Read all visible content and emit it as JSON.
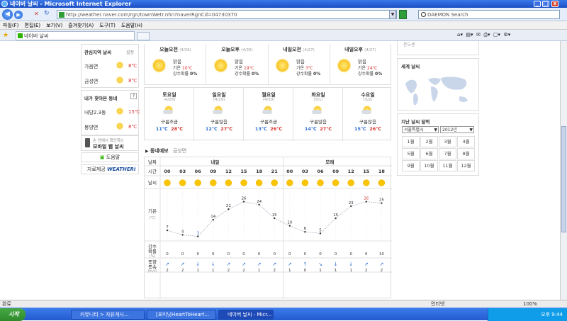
{
  "window": {
    "title": "네이버 날씨 - Microsoft Internet Explorer"
  },
  "address": {
    "url": "http://weather.naver.com/rgn/townWetr.nhn?naverRgnCd=04730370",
    "search_placeholder": "DAEMON Search"
  },
  "menu": [
    "파일(F)",
    "편집(E)",
    "보기(V)",
    "즐겨찾기(A)",
    "도구(T)",
    "도움말(H)"
  ],
  "tab": {
    "label": "네이버 날씨"
  },
  "sidebar": {
    "fav_title": "관심지역 날씨",
    "fav_setting": "설정",
    "fav_items": [
      {
        "name": "가음면",
        "temp": "8℃"
      },
      {
        "name": "금성면",
        "temp": "8℃"
      }
    ],
    "nearby_title": "내가 찾아본 동네",
    "nearby_help": "?",
    "nearby_items": [
      {
        "name": "내당2.3동",
        "temp": "15℃"
      },
      {
        "name": "봉양면",
        "temp": "8℃"
      }
    ],
    "mobile_small": "손 안에서 확인하는",
    "mobile_big": "모바일 웹 날씨",
    "help": "도움말",
    "source_label": "자료제공",
    "source_brand": "WEATHERi"
  },
  "forecast2day": [
    {
      "label": "오늘오전",
      "date": "(4/26)",
      "desc": "맑음",
      "temp_label": "기온",
      "temp": "10℃",
      "rain_label": "강수확률",
      "rain": "0%"
    },
    {
      "label": "오늘오후",
      "date": "(4/26)",
      "desc": "맑음",
      "temp_label": "기온",
      "temp": "19℃",
      "rain_label": "강수확률",
      "rain": "0%"
    },
    {
      "label": "내일오전",
      "date": "(4/27)",
      "desc": "맑음",
      "temp_label": "기온",
      "temp": "3℃",
      "rain_label": "강수확률",
      "rain": "0%"
    },
    {
      "label": "내일오후",
      "date": "(4/27)",
      "desc": "맑음",
      "temp_label": "기온",
      "temp": "24℃",
      "rain_label": "강수확률",
      "rain": "0%"
    }
  ],
  "weekly": [
    {
      "day": "토요일",
      "date": "(4/28)",
      "desc": "구름조금",
      "low": "11℃",
      "high": "28℃"
    },
    {
      "day": "일요일",
      "date": "(4/29)",
      "desc": "구름많음",
      "low": "12℃",
      "high": "27℃"
    },
    {
      "day": "월요일",
      "date": "(4/30)",
      "desc": "구름조금",
      "low": "13℃",
      "high": "26℃"
    },
    {
      "day": "화요일",
      "date": "(5/1)",
      "desc": "구름많음",
      "low": "14℃",
      "high": "27℃"
    },
    {
      "day": "수요일",
      "date": "(5/2)",
      "desc": "구름많음",
      "low": "15℃",
      "high": "26℃"
    }
  ],
  "town": {
    "title": "동네예보",
    "region": "금성면",
    "row_labels": {
      "date": "날짜",
      "time": "시간",
      "weather": "날씨",
      "temp": "기온",
      "temp_unit": "(℃)",
      "rain": "강수확률",
      "rain_unit": "(%)",
      "wind": "풍향풍속",
      "wind_unit": "(m/s)"
    },
    "day_labels": [
      "내일",
      "모레"
    ],
    "hours": [
      "00",
      "03",
      "06",
      "09",
      "12",
      "15",
      "18",
      "21",
      "00",
      "03",
      "06",
      "09",
      "12",
      "15",
      "18"
    ],
    "temps": [
      7,
      4,
      3,
      14,
      21,
      26,
      24,
      15,
      10,
      6,
      5,
      15,
      23,
      26,
      25
    ],
    "rain": [
      "0",
      "0",
      "0",
      "0",
      "0",
      "0",
      "0",
      "0",
      "0",
      "0",
      "0",
      "0",
      "0",
      "0",
      "10"
    ],
    "wind": [
      "2",
      "2",
      "1",
      "1",
      "2",
      "2",
      "1",
      "2",
      "1",
      "0",
      "1",
      "1",
      "1",
      "2",
      "2"
    ],
    "wind_arrows": [
      "↗",
      "↗",
      "↓",
      "↓",
      "↗",
      "↗",
      "↗",
      "↗",
      "↗",
      "↑",
      "↘",
      "↓",
      "↓",
      "↗",
      "↗"
    ]
  },
  "right": {
    "top_text": "온도센",
    "world_title": "세계 날씨",
    "past_title": "지난 날씨 달력",
    "city": "서울특별시",
    "year": "2012년",
    "months": [
      "1월",
      "2월",
      "3월",
      "4월",
      "5월",
      "6월",
      "7월",
      "8월",
      "9월",
      "10월",
      "11월",
      "12월"
    ]
  },
  "status": {
    "left": "완료",
    "zone": "인터넷",
    "zoom": "100%"
  },
  "taskbar": {
    "start": "시작",
    "tasks": [
      "커뮤니티 > 자유게시...",
      "[포미닛HeartToHeart...",
      "네이버 날씨 - Micr..."
    ],
    "clock": "오후 9:44"
  }
}
